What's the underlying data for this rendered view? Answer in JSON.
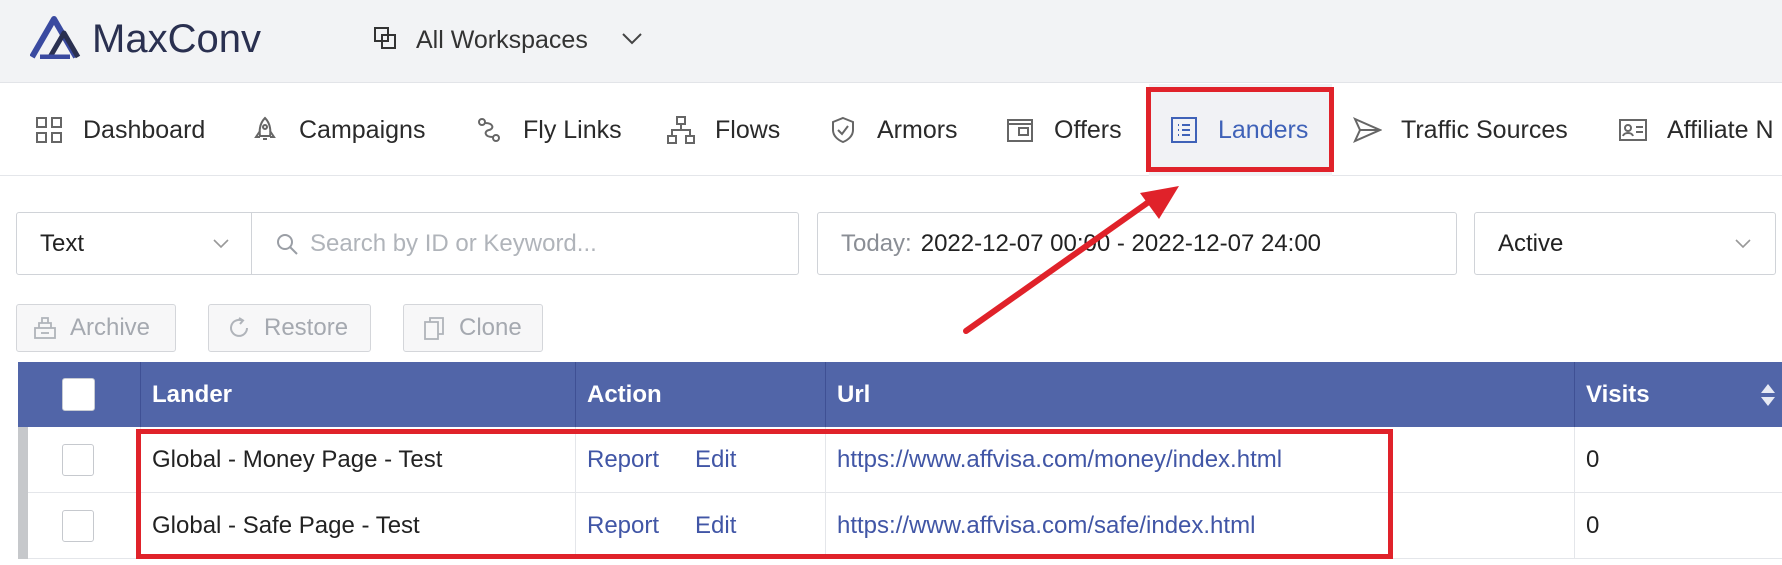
{
  "app": {
    "brand": "MaxConv",
    "workspace": "All Workspaces"
  },
  "nav": {
    "items": [
      {
        "label": "Dashboard",
        "icon": "dashboard-icon"
      },
      {
        "label": "Campaigns",
        "icon": "rocket-icon"
      },
      {
        "label": "Fly Links",
        "icon": "fly-links-icon"
      },
      {
        "label": "Flows",
        "icon": "flows-icon"
      },
      {
        "label": "Armors",
        "icon": "shield-check-icon"
      },
      {
        "label": "Offers",
        "icon": "offers-icon"
      },
      {
        "label": "Landers",
        "icon": "list-icon"
      },
      {
        "label": "Traffic Sources",
        "icon": "send-icon"
      },
      {
        "label": "Affiliate N",
        "icon": "id-card-icon"
      }
    ],
    "active": "Landers"
  },
  "filters": {
    "type": "Text",
    "search_placeholder": "Search by ID or Keyword...",
    "date_prefix": "Today:",
    "date_range": "2022-12-07 00:00 - 2022-12-07 24:00",
    "status": "Active"
  },
  "actions": {
    "archive": "Archive",
    "restore": "Restore",
    "clone": "Clone"
  },
  "table": {
    "columns": [
      "Lander",
      "Action",
      "Url",
      "Visits"
    ],
    "rows": [
      {
        "lander": "Global - Money Page - Test",
        "report": "Report",
        "edit": "Edit",
        "url": "https://www.affvisa.com/money/index.html",
        "visits": "0"
      },
      {
        "lander": "Global - Safe Page - Test",
        "report": "Report",
        "edit": "Edit",
        "url": "https://www.affvisa.com/safe/index.html",
        "visits": "0"
      }
    ]
  },
  "colors": {
    "accent": "#3f62b8",
    "table_header": "#5165a8",
    "link": "#4156a6",
    "annotation": "#e0222a"
  }
}
